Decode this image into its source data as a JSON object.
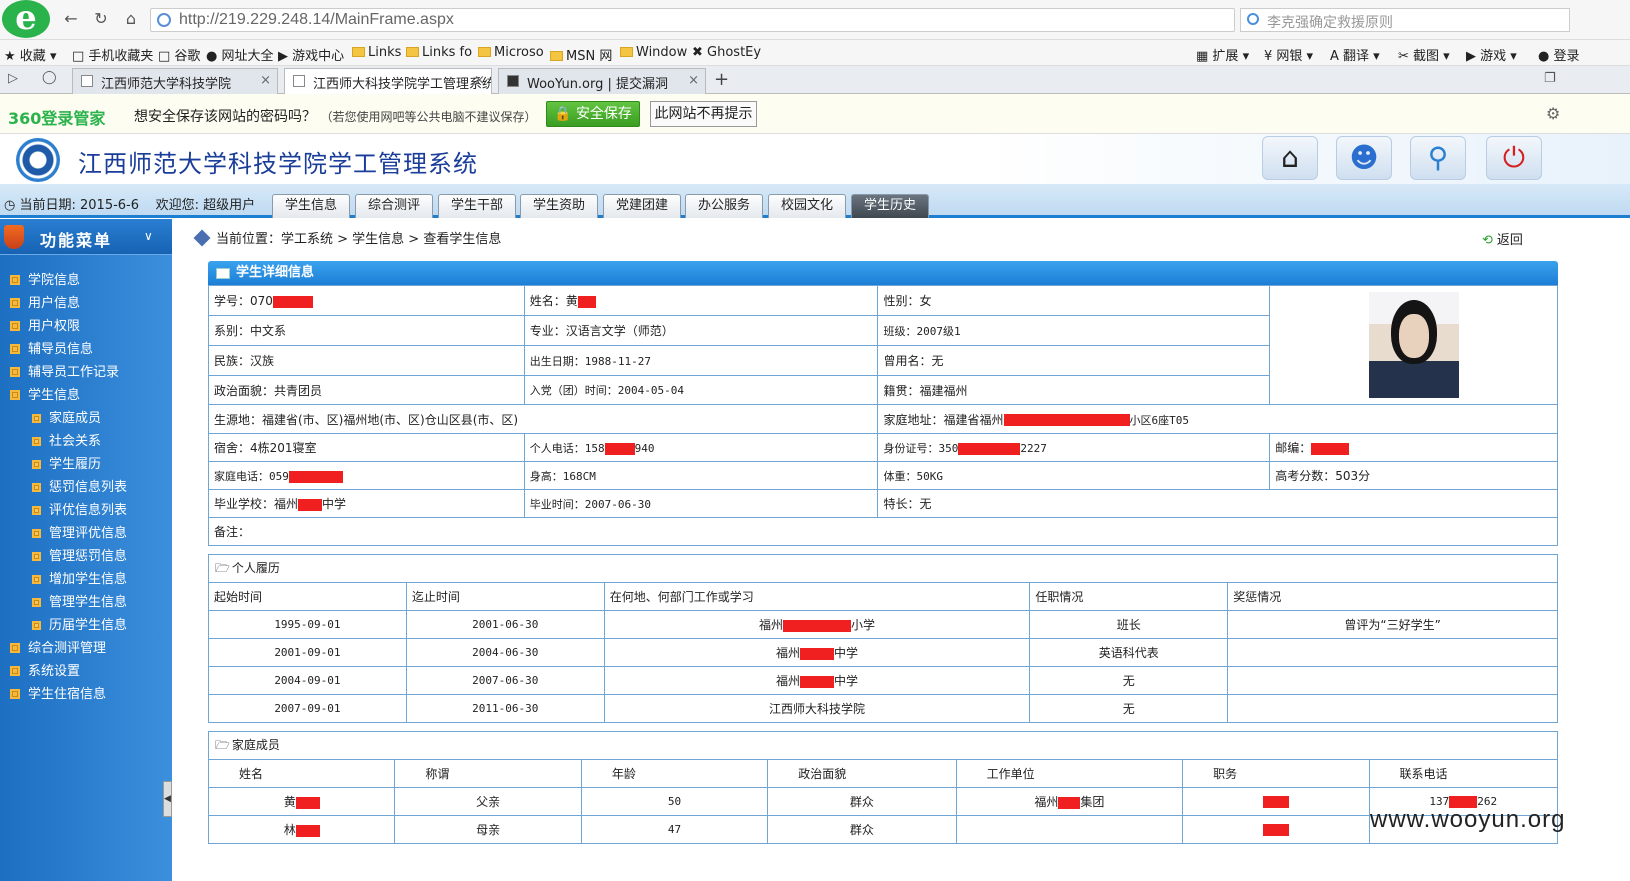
{
  "browser": {
    "url": "http://219.229.248.14/MainFrame.aspx",
    "search_placeholder": "李克强确定救援原则",
    "bookmarks": [
      "收藏",
      "手机收藏夹",
      "谷歌",
      "网址大全",
      "游戏中心",
      "Links",
      "Links fo",
      "Microso",
      "MSN 网",
      "Window",
      "GhostEy"
    ],
    "right_tools": [
      "扩展",
      "网银",
      "翻译",
      "截图",
      "游戏",
      "登录"
    ],
    "tabs": [
      {
        "label": "江西师范大学科技学院",
        "active": false
      },
      {
        "label": "江西师大科技学院学工管理系统",
        "active": true
      },
      {
        "label": "WooYun.org | 提交漏洞",
        "active": false
      }
    ],
    "pw_brand": "360登录管家",
    "pw_message": "想安全保存该网站的密码吗？",
    "pw_note": "（若您使用网吧等公共电脑不建议保存）",
    "pw_save": "安全保存",
    "pw_never": "此网站不再提示"
  },
  "app": {
    "title": "江西师范大学科技学院学工管理系统",
    "date_label": "当前日期:",
    "date": "2015-6-6",
    "welcome_label": "欢迎您:",
    "user": "超级用户",
    "menu": [
      "学生信息",
      "综合测评",
      "学生干部",
      "学生资助",
      "党建团建",
      "办公服务",
      "校园文化",
      "学生历史"
    ],
    "active_menu": 7,
    "header_icons": [
      "home-icon",
      "user-edit-icon",
      "search-icon",
      "power-icon"
    ]
  },
  "sidebar": {
    "title": "功能菜单",
    "items": [
      {
        "label": "学院信息",
        "sub": false
      },
      {
        "label": "用户信息",
        "sub": false
      },
      {
        "label": "用户权限",
        "sub": false
      },
      {
        "label": "辅导员信息",
        "sub": false
      },
      {
        "label": "辅导员工作记录",
        "sub": false
      },
      {
        "label": "学生信息",
        "sub": false
      },
      {
        "label": "家庭成员",
        "sub": true
      },
      {
        "label": "社会关系",
        "sub": true
      },
      {
        "label": "学生履历",
        "sub": true
      },
      {
        "label": "惩罚信息列表",
        "sub": true
      },
      {
        "label": "评优信息列表",
        "sub": true
      },
      {
        "label": "管理评优信息",
        "sub": true
      },
      {
        "label": "管理惩罚信息",
        "sub": true
      },
      {
        "label": "增加学生信息",
        "sub": true
      },
      {
        "label": "管理学生信息",
        "sub": true
      },
      {
        "label": "历届学生信息",
        "sub": true
      },
      {
        "label": "综合测评管理",
        "sub": false
      },
      {
        "label": "系统设置",
        "sub": false
      },
      {
        "label": "学生住宿信息",
        "sub": false
      }
    ]
  },
  "main": {
    "breadcrumb": "当前位置：学工系统 > 学生信息 > 查看学生信息",
    "back": "返回",
    "panel_title": "学生详细信息",
    "info": {
      "student_no": "学号：070",
      "name": "姓名：黄",
      "gender": "性别：女",
      "dept": "系别：中文系",
      "major": "专业：汉语言文学（师范）",
      "class": "班级：2007级1",
      "ethnic": "民族：汉族",
      "birth": "出生日期：1988-11-27",
      "former_name": "曾用名：无",
      "political": "政治面貌：共青团员",
      "join_date": "入党（团）时间：2004-05-04",
      "origin": "籍贯：福建福州",
      "source": "生源地：福建省(市、区)福州地(市、区)仓山区县(市、区)",
      "address_a": "家庭地址：福建省福州",
      "address_b": "小区6座T05",
      "dorm": "宿舍：4栋201寝室",
      "phone_a": "个人电话：158",
      "phone_b": "940",
      "id_a": "身份证号：350",
      "id_b": "2227",
      "zip": "邮编：",
      "home_phone": "家庭电话：059",
      "height": "身高：168CM",
      "weight": "体重：50KG",
      "score": "高考分数：503分",
      "school_a": "毕业学校：福州",
      "school_b": "中学",
      "grad": "毕业时间：2007-06-30",
      "talent": "特长：无",
      "remark": "备注："
    },
    "resume_title": "个人履历",
    "resume_headers": [
      "起始时间",
      "迄止时间",
      "在何地、何部门工作或学习",
      "任职情况",
      "奖惩情况"
    ],
    "resume_rows": [
      {
        "start": "1995-09-01",
        "end": "2001-06-30",
        "place_a": "福州",
        "place_b": "小学",
        "role": "班长",
        "award": "曾评为“三好学生”"
      },
      {
        "start": "2001-09-01",
        "end": "2004-06-30",
        "place_a": "福州",
        "place_b": "中学",
        "role": "英语科代表",
        "award": ""
      },
      {
        "start": "2004-09-01",
        "end": "2007-06-30",
        "place_a": "福州",
        "place_b": "中学",
        "role": "无",
        "award": ""
      },
      {
        "start": "2007-09-01",
        "end": "2011-06-30",
        "place_a": "江西师大科技学院",
        "place_b": "",
        "role": "无",
        "award": ""
      }
    ],
    "family_title": "家庭成员",
    "family_headers": [
      "姓名",
      "称谓",
      "年龄",
      "政治面貌",
      "工作单位",
      "职务",
      "联系电话"
    ],
    "family_rows": [
      {
        "name": "黄",
        "rel": "父亲",
        "age": "50",
        "pol": "群众",
        "work_a": "福州",
        "work_b": "集团",
        "phone_a": "137",
        "phone_b": "262"
      },
      {
        "name": "林",
        "rel": "母亲",
        "age": "47",
        "pol": "群众",
        "work_a": "",
        "work_b": "",
        "phone_a": "",
        "phone_b": ""
      }
    ]
  },
  "watermark": "www.wooyun.org",
  "colors": {
    "accent": "#1c7fd6",
    "sidebar": "#2a7fd2",
    "redaction": "#f02020",
    "save_green": "#3a9d22"
  }
}
